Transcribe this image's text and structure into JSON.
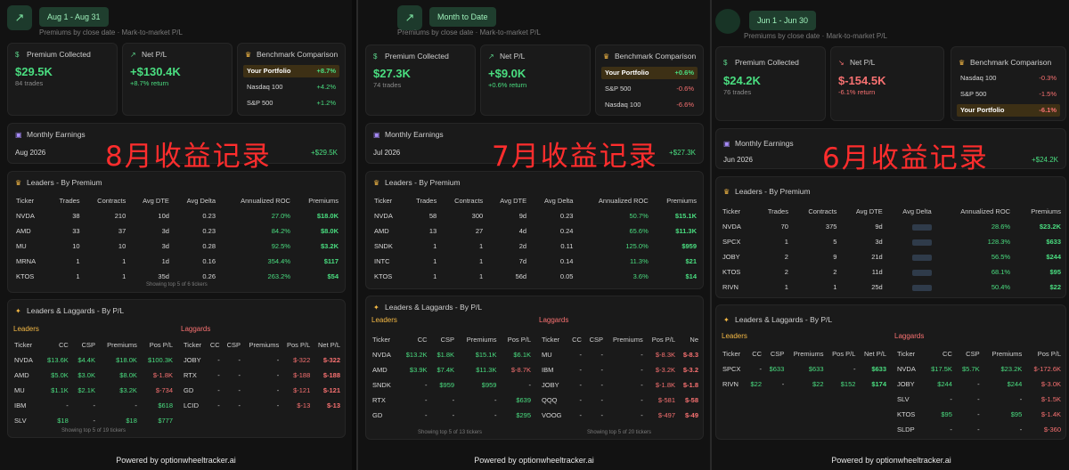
{
  "colors": {
    "accent_green": "#4ade80",
    "accent_red": "#f87171",
    "highlight": "#3d3015",
    "overlay_red": "#ff2d2d"
  },
  "footer": "Powered by optionwheeltracker.ai",
  "subheader": "Premiums by close date · Mark-to-market P/L",
  "labels": {
    "premium_collected": "Premium Collected",
    "net_pl": "Net P/L",
    "benchmark": "Benchmark Comparison",
    "monthly_earnings": "Monthly Earnings",
    "leaders_by_premium": "Leaders - By Premium",
    "leaders_laggards": "Leaders & Laggards - By P/L",
    "leaders": "Leaders",
    "laggards": "Laggards"
  },
  "panels": [
    {
      "date_range": "Aug 1 - Aug 31",
      "premium": "$29.5K",
      "trades": "84 trades",
      "net_pl": "+$130.4K",
      "net_return": "+8.7% return",
      "benchmarks": [
        {
          "name": "Your Portfolio",
          "value": "+8.7%"
        },
        {
          "name": "Nasdaq 100",
          "value": "+4.2%"
        },
        {
          "name": "S&P 500",
          "value": "+1.2%"
        }
      ],
      "month": "Aug 2026",
      "month_value": "+$29.5K",
      "overlay": "8月收益记录",
      "premium_headers": [
        "Ticker",
        "Trades",
        "Contracts",
        "Avg DTE",
        "Avg Delta",
        "Annualized ROC",
        "Premiums"
      ],
      "premium_rows": [
        [
          "NVDA",
          "38",
          "210",
          "10d",
          "0.23",
          "27.0%",
          "$18.0K"
        ],
        [
          "AMD",
          "33",
          "37",
          "3d",
          "0.23",
          "84.2%",
          "$8.0K"
        ],
        [
          "MU",
          "10",
          "10",
          "3d",
          "0.28",
          "92.5%",
          "$3.2K"
        ],
        [
          "MRNA",
          "1",
          "1",
          "1d",
          "0.16",
          "354.4%",
          "$117"
        ],
        [
          "KTOS",
          "1",
          "1",
          "35d",
          "0.26",
          "263.2%",
          "$54"
        ]
      ],
      "premium_footer": "Showing top 5 of 6 tickers",
      "leaders_headers": [
        "Ticker",
        "CC",
        "CSP",
        "Premiums",
        "Pos P/L"
      ],
      "leaders_rows": [
        [
          "NVDA",
          "$13.6K",
          "$4.4K",
          "$18.0K",
          "$100.3K"
        ],
        [
          "AMD",
          "$5.0K",
          "$3.0K",
          "$8.0K",
          "$-1.8K"
        ],
        [
          "MU",
          "$1.1K",
          "$2.1K",
          "$3.2K",
          "$-734"
        ],
        [
          "IBM",
          "-",
          "-",
          "-",
          "$618"
        ],
        [
          "SLV",
          "$18",
          "-",
          "$18",
          "$777"
        ]
      ],
      "laggards_headers": [
        "Ticker",
        "CC",
        "CSP",
        "Premiums",
        "Pos P/L",
        "Net P/L"
      ],
      "laggards_rows": [
        [
          "JOBY",
          "-",
          "-",
          "-",
          "$-322",
          "$-322"
        ],
        [
          "RTX",
          "-",
          "-",
          "-",
          "$-188",
          "$-188"
        ],
        [
          "GD",
          "-",
          "-",
          "-",
          "$-121",
          "$-121"
        ],
        [
          "LCID",
          "-",
          "-",
          "-",
          "$-13",
          "$-13"
        ]
      ],
      "ll_footer": "Showing top 5 of 19 tickers"
    },
    {
      "date_range": "Month to Date",
      "premium": "$27.3K",
      "trades": "74 trades",
      "net_pl": "+$9.0K",
      "net_return": "+0.6% return",
      "benchmarks": [
        {
          "name": "Your Portfolio",
          "value": "+0.6%"
        },
        {
          "name": "S&P 500",
          "value": "-0.6%"
        },
        {
          "name": "Nasdaq 100",
          "value": "-6.6%"
        }
      ],
      "month": "Jul 2026",
      "month_value": "+$27.3K",
      "overlay": "7月收益记录",
      "premium_headers": [
        "Ticker",
        "Trades",
        "Contracts",
        "Avg DTE",
        "Avg Delta",
        "Annualized ROC",
        "Premiums"
      ],
      "premium_rows": [
        [
          "NVDA",
          "58",
          "300",
          "9d",
          "0.23",
          "50.7%",
          "$15.1K"
        ],
        [
          "AMD",
          "13",
          "27",
          "4d",
          "0.24",
          "65.6%",
          "$11.3K"
        ],
        [
          "SNDK",
          "1",
          "1",
          "2d",
          "0.11",
          "125.0%",
          "$959"
        ],
        [
          "INTC",
          "1",
          "1",
          "7d",
          "0.14",
          "11.3%",
          "$21"
        ],
        [
          "KTOS",
          "1",
          "1",
          "56d",
          "0.05",
          "3.6%",
          "$14"
        ]
      ],
      "premium_footer": "",
      "leaders_headers": [
        "Ticker",
        "CC",
        "CSP",
        "Premiums",
        "Pos P/L"
      ],
      "leaders_rows": [
        [
          "NVDA",
          "$13.2K",
          "$1.8K",
          "$15.1K",
          "$6.1K"
        ],
        [
          "AMD",
          "$3.9K",
          "$7.4K",
          "$11.3K",
          "$-8.7K"
        ],
        [
          "SNDK",
          "-",
          "$959",
          "$959",
          "-"
        ],
        [
          "RTX",
          "-",
          "-",
          "-",
          "$639"
        ],
        [
          "GD",
          "-",
          "-",
          "-",
          "$295"
        ]
      ],
      "leaders_footer": "Showing top 5 of 13 tickers",
      "laggards_headers": [
        "Ticker",
        "CC",
        "CSP",
        "Premiums",
        "Pos P/L",
        "Ne"
      ],
      "laggards_rows": [
        [
          "MU",
          "-",
          "-",
          "-",
          "$-8.3K",
          "$-8.3"
        ],
        [
          "IBM",
          "-",
          "-",
          "-",
          "$-3.2K",
          "$-3.2"
        ],
        [
          "JOBY",
          "-",
          "-",
          "-",
          "$-1.8K",
          "$-1.8"
        ],
        [
          "QQQ",
          "-",
          "-",
          "-",
          "$-581",
          "$-58"
        ],
        [
          "VOOG",
          "-",
          "-",
          "-",
          "$-497",
          "$-49"
        ]
      ],
      "laggards_footer": "Showing top 5 of 20 tickers"
    },
    {
      "date_range": "Jun 1 - Jun 30",
      "premium": "$24.2K",
      "trades": "76 trades",
      "net_pl": "$-154.5K",
      "net_return": "-6.1% return",
      "benchmarks": [
        {
          "name": "Nasdaq 100",
          "value": "-0.3%"
        },
        {
          "name": "S&P 500",
          "value": "-1.5%"
        },
        {
          "name": "Your Portfolio",
          "value": "-6.1%"
        }
      ],
      "month": "Jun 2026",
      "month_value": "+$24.2K",
      "overlay": "6月收益记录",
      "premium_headers": [
        "Ticker",
        "Trades",
        "Contracts",
        "Avg DTE",
        "Avg Delta",
        "Annualized ROC",
        "Premiums"
      ],
      "premium_rows": [
        [
          "NVDA",
          "70",
          "375",
          "9d",
          "",
          "28.6%",
          "$23.2K"
        ],
        [
          "SPCX",
          "1",
          "5",
          "3d",
          "",
          "128.3%",
          "$633"
        ],
        [
          "JOBY",
          "2",
          "9",
          "21d",
          "",
          "56.5%",
          "$244"
        ],
        [
          "KTOS",
          "2",
          "2",
          "11d",
          "",
          "68.1%",
          "$95"
        ],
        [
          "RIVN",
          "1",
          "1",
          "25d",
          "",
          "50.4%",
          "$22"
        ]
      ],
      "leaders_headers": [
        "Ticker",
        "CC",
        "CSP",
        "Premiums",
        "Pos P/L",
        "Net P/L"
      ],
      "leaders_rows": [
        [
          "SPCX",
          "-",
          "$633",
          "$633",
          "-",
          "$633"
        ],
        [
          "RIVN",
          "$22",
          "-",
          "$22",
          "$152",
          "$174"
        ]
      ],
      "laggards_headers": [
        "Ticker",
        "CC",
        "CSP",
        "Premiums",
        "Pos P/L"
      ],
      "laggards_rows": [
        [
          "NVDA",
          "$17.5K",
          "$5.7K",
          "$23.2K",
          "$-172.6K"
        ],
        [
          "JOBY",
          "$244",
          "-",
          "$244",
          "$-3.0K"
        ],
        [
          "SLV",
          "-",
          "-",
          "-",
          "$-1.5K"
        ],
        [
          "KTOS",
          "$95",
          "-",
          "$95",
          "$-1.4K"
        ],
        [
          "SLDP",
          "-",
          "-",
          "-",
          "$-360"
        ]
      ]
    }
  ]
}
